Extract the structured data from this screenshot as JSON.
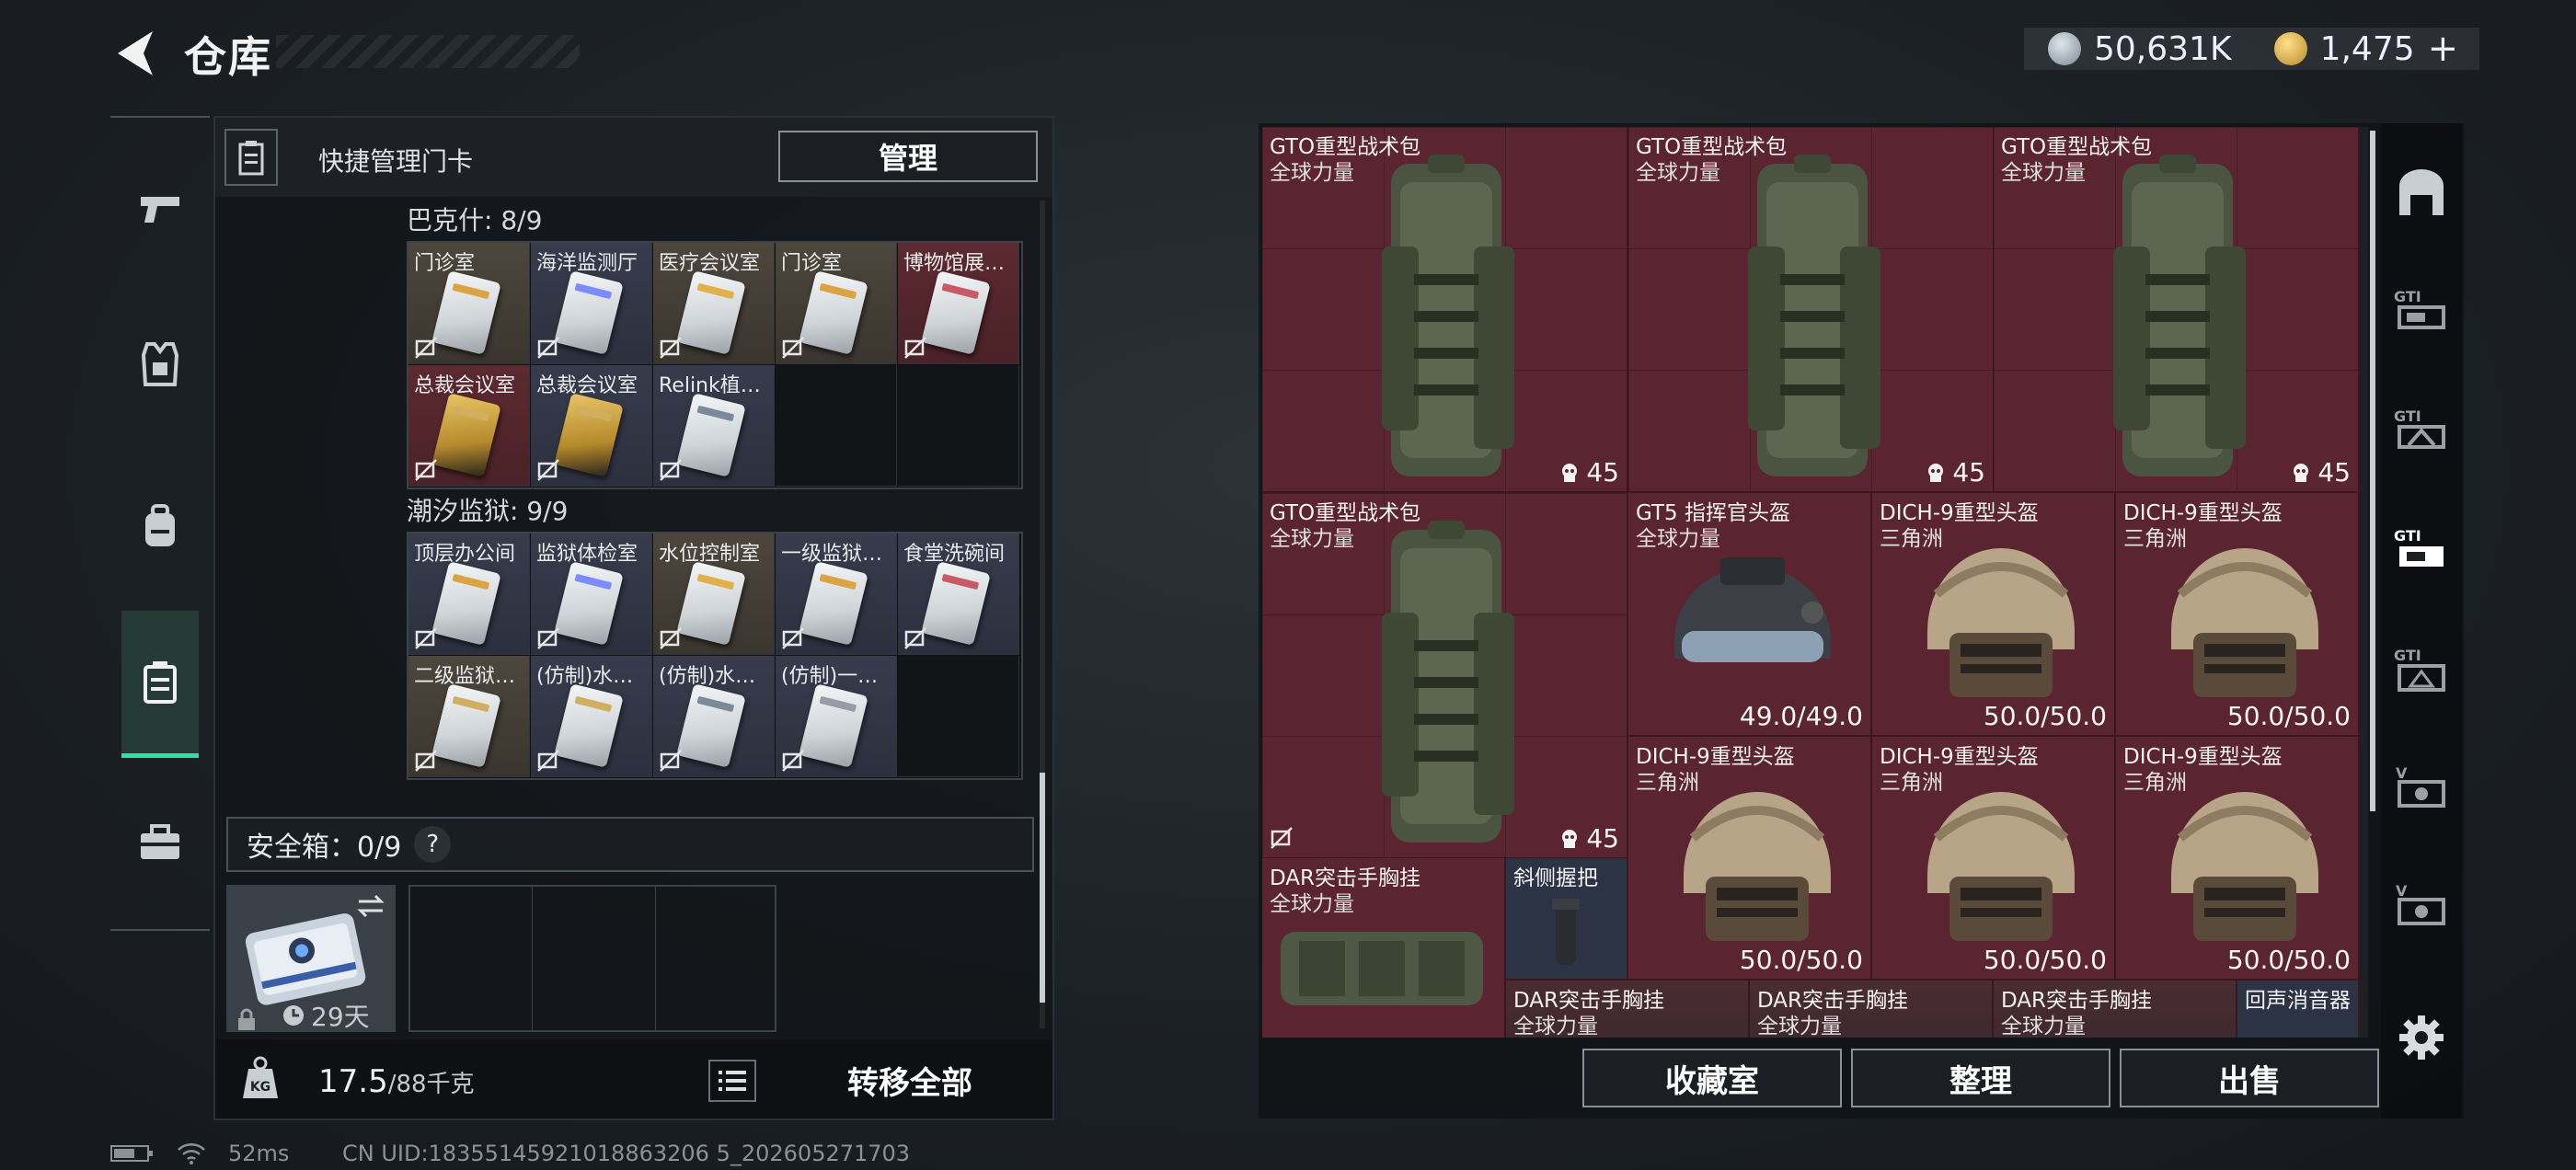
{
  "header": {
    "title": "仓库"
  },
  "currency": {
    "silver": "50,631K",
    "gold": "1,475",
    "add": "+"
  },
  "left_nav": [
    "firearm",
    "armor",
    "backpack",
    "keycard",
    "toolbox"
  ],
  "keycard_panel": {
    "title": "快捷管理门卡",
    "manage": "管理",
    "groups": [
      {
        "title": "巴克什: 8/9",
        "cards": [
          {
            "label": "门诊室",
            "color": "tan"
          },
          {
            "label": "海洋监测厅",
            "color": "navy"
          },
          {
            "label": "医疗会议室",
            "color": "tan"
          },
          {
            "label": "门诊室",
            "color": "tan"
          },
          {
            "label": "博物馆展…",
            "color": "red"
          },
          {
            "label": "总裁会议室",
            "color": "red"
          },
          {
            "label": "总裁会议室",
            "color": "navy"
          },
          {
            "label": "Relink植…",
            "color": "navy"
          }
        ]
      },
      {
        "title": "潮汐监狱: 9/9",
        "cards": [
          {
            "label": "顶层办公间",
            "color": "navy"
          },
          {
            "label": "监狱体检室",
            "color": "navy"
          },
          {
            "label": "水位控制室",
            "color": "tan"
          },
          {
            "label": "一级监狱…",
            "color": "navy"
          },
          {
            "label": "食堂洗碗间",
            "color": "navy"
          },
          {
            "label": "二级监狱…",
            "color": "tan"
          },
          {
            "label": "(仿制)水…",
            "color": "navy"
          },
          {
            "label": "(仿制)水…",
            "color": "navy"
          },
          {
            "label": "(仿制)一…",
            "color": "navy"
          }
        ]
      }
    ],
    "safebox": {
      "label": "安全箱：0/9",
      "help": "?",
      "timer": "29天"
    },
    "weight": {
      "current": "17.5",
      "max": "/88千克"
    },
    "transfer_all": "转移全部"
  },
  "stash": {
    "items": [
      {
        "name": "GTO重型战术包",
        "tag": "全球力量",
        "value": "45",
        "kind": "backpack"
      },
      {
        "name": "GTO重型战术包",
        "tag": "全球力量",
        "value": "45",
        "kind": "backpack"
      },
      {
        "name": "GTO重型战术包",
        "tag": "全球力量",
        "value": "45",
        "kind": "backpack"
      },
      {
        "name": "GTO重型战术包",
        "tag": "全球力量",
        "value": "45",
        "kind": "backpack"
      },
      {
        "name": "GT5 指挥官头盔",
        "tag": "全球力量",
        "value": "49.0/49.0",
        "kind": "helmet-gt5"
      },
      {
        "name": "DICH-9重型头盔",
        "tag": "三角洲",
        "value": "50.0/50.0",
        "kind": "helmet"
      },
      {
        "name": "DICH-9重型头盔",
        "tag": "三角洲",
        "value": "50.0/50.0",
        "kind": "helmet"
      },
      {
        "name": "DICH-9重型头盔",
        "tag": "三角洲",
        "value": "50.0/50.0",
        "kind": "helmet"
      },
      {
        "name": "DICH-9重型头盔",
        "tag": "三角洲",
        "value": "50.0/50.0",
        "kind": "helmet"
      },
      {
        "name": "DICH-9重型头盔",
        "tag": "三角洲",
        "value": "50.0/50.0",
        "kind": "helmet"
      },
      {
        "name": "DAR突击手胸挂",
        "tag": "全球力量",
        "value": "",
        "kind": "rig"
      },
      {
        "name": "斜侧握把",
        "tag": "",
        "value": "",
        "kind": "grip"
      },
      {
        "name": "DAR突击手胸挂",
        "tag": "全球力量",
        "value": "",
        "kind": "rig"
      },
      {
        "name": "DAR突击手胸挂",
        "tag": "全球力量",
        "value": "",
        "kind": "rig"
      },
      {
        "name": "DAR突击手胸挂",
        "tag": "全球力量",
        "value": "",
        "kind": "rig"
      },
      {
        "name": "回声消音器",
        "tag": "",
        "value": "",
        "kind": "muzzle"
      }
    ],
    "buttons": {
      "collection": "收藏室",
      "sort": "整理",
      "sell": "出售"
    }
  },
  "status_bar": {
    "ping": "52ms",
    "uid": "CN UID:18355145921018863206 5_202605271703"
  },
  "colors": {
    "accent": "#2ee0a1",
    "item_red": "#5a2430",
    "item_navy": "#2c3345"
  }
}
